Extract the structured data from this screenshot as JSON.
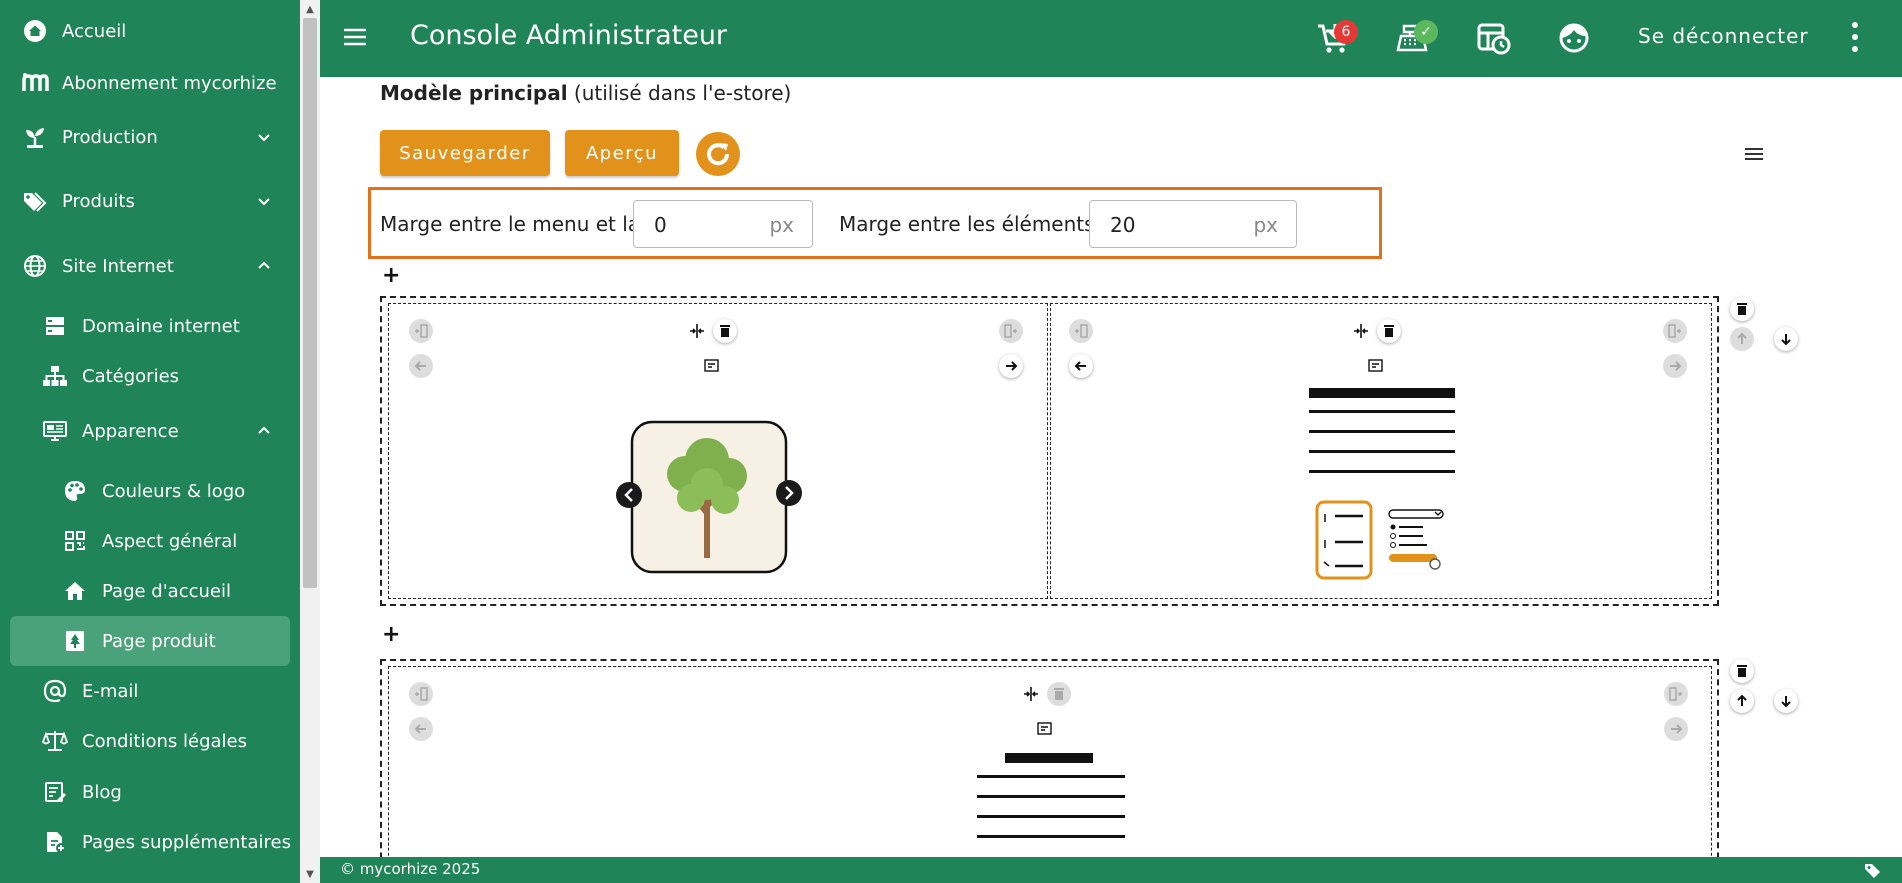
{
  "sidebar": {
    "items": [
      {
        "label": "Accueil",
        "icon": "home-icon"
      },
      {
        "label": "Abonnement mycorhize",
        "icon": "m-logo-icon"
      },
      {
        "label": "Production",
        "icon": "seedling-icon"
      },
      {
        "label": "Produits",
        "icon": "tags-icon"
      },
      {
        "label": "Site Internet",
        "icon": "globe-icon"
      },
      {
        "label": "Domaine internet",
        "icon": "server-icon"
      },
      {
        "label": "Catégories",
        "icon": "sitemap-icon"
      },
      {
        "label": "Apparence",
        "icon": "monitor-icon"
      },
      {
        "label": "Couleurs & logo",
        "icon": "palette-icon"
      },
      {
        "label": "Aspect général",
        "icon": "qr-code-icon"
      },
      {
        "label": "Page d'accueil",
        "icon": "house-icon"
      },
      {
        "label": "Page produit",
        "icon": "tree-page-icon"
      },
      {
        "label": "E-mail",
        "icon": "at-icon"
      },
      {
        "label": "Conditions légales",
        "icon": "scale-icon"
      },
      {
        "label": "Blog",
        "icon": "blog-icon"
      },
      {
        "label": "Pages supplémentaires",
        "icon": "file-plus-icon"
      }
    ]
  },
  "header": {
    "title": "Console Administrateur",
    "cart_badge": "6",
    "logout_label": "Se déconnecter"
  },
  "main": {
    "model_title_bold": "Modèle principal",
    "model_title_rest": " (utilisé dans l'e-store)",
    "save_label": "Sauvegarder",
    "preview_label": "Aperçu",
    "margin_menu_label": "Marge entre le menu et la page:",
    "margin_menu_value": "0",
    "margin_elements_label": "Marge entre les éléments:",
    "margin_elements_value": "20",
    "unit": "px",
    "add_symbol": "+"
  },
  "footer": {
    "text": "© mycorhize 2025"
  },
  "colors": {
    "brand_green": "#1f8457",
    "accent_orange": "#e2921a",
    "highlight_orange": "#e2711a",
    "badge_red": "#e53935",
    "badge_green": "#5cb85c"
  }
}
